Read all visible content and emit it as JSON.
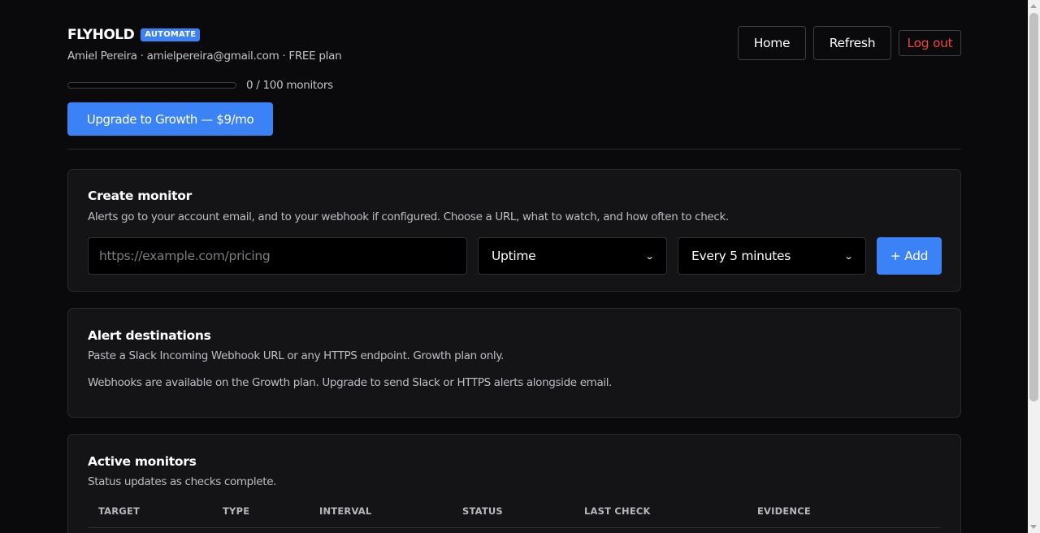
{
  "header": {
    "brand": "FLYHOLD",
    "badge": "AUTOMATE",
    "user_line": "Amiel Pereira · amielpereira@gmail.com · FREE plan",
    "usage_text": "0 / 100 monitors",
    "usage_fraction": 0,
    "upgrade_label": "Upgrade to Growth — $9/mo",
    "nav": {
      "home": "Home",
      "refresh": "Refresh",
      "logout": "Log out"
    }
  },
  "create_monitor": {
    "title": "Create monitor",
    "subtitle": "Alerts go to your account email, and to your webhook if configured. Choose a URL, what to watch, and how often to check.",
    "url_placeholder": "https://example.com/pricing",
    "url_value": "",
    "type_selected": "Uptime",
    "interval_selected": "Every 5 minutes",
    "add_label": "+ Add"
  },
  "alert_destinations": {
    "title": "Alert destinations",
    "subtitle": "Paste a Slack Incoming Webhook URL or any HTTPS endpoint. Growth plan only.",
    "note": "Webhooks are available on the Growth plan. Upgrade to send Slack or HTTPS alerts alongside email."
  },
  "active_monitors": {
    "title": "Active monitors",
    "subtitle": "Status updates as checks complete.",
    "columns": [
      "TARGET",
      "TYPE",
      "INTERVAL",
      "STATUS",
      "LAST CHECK",
      "EVIDENCE"
    ]
  },
  "colors": {
    "accent": "#3b82f6",
    "danger": "#ef4444",
    "background": "#0a0a0d",
    "card": "#141417"
  },
  "icons": {
    "select_chevron": "chevron-down-icon",
    "scroll_up": "scroll-up-arrow-icon",
    "scroll_down": "scroll-down-arrow-icon"
  }
}
